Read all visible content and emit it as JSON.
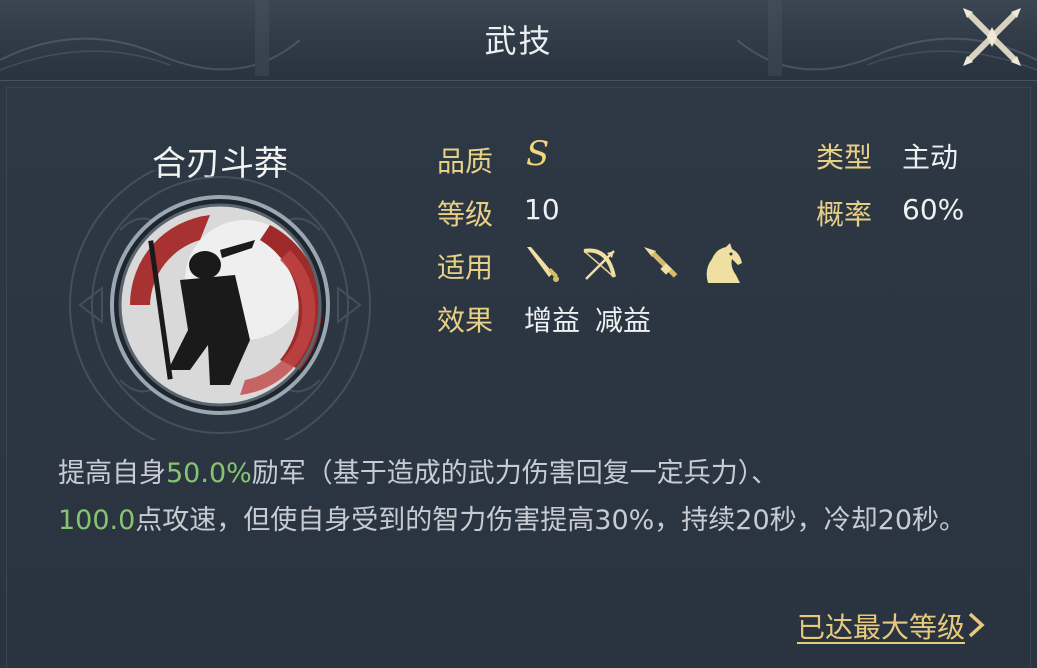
{
  "header": {
    "title": "武技"
  },
  "skill": {
    "name": "合刃斗莽",
    "quality_label": "品质",
    "quality_value": "S",
    "level_label": "等级",
    "level_value": "10",
    "applies_label": "适用",
    "applies_icons": [
      "sword-icon",
      "bow-icon",
      "spear-icon",
      "horse-icon"
    ],
    "effect_label": "效果",
    "effect_values": [
      "增益",
      "减益"
    ],
    "type_label": "类型",
    "type_value": "主动",
    "chance_label": "概率",
    "chance_value": "60%"
  },
  "description": {
    "p1": "提高自身",
    "h1": "50.0%",
    "p2": "励军（基于造成的武力伤害回复一定兵力）、",
    "h2": "100.0",
    "p3": "点攻速，但使自身受到的智力伤害提高30%，持续20秒，冷却20秒。"
  },
  "footer": {
    "max_level_label": "已达最大等级"
  },
  "colors": {
    "label_gold": "#e8cf86",
    "highlight_green": "#86c56f",
    "text": "#c8ccd2",
    "background": "#2a3440"
  }
}
